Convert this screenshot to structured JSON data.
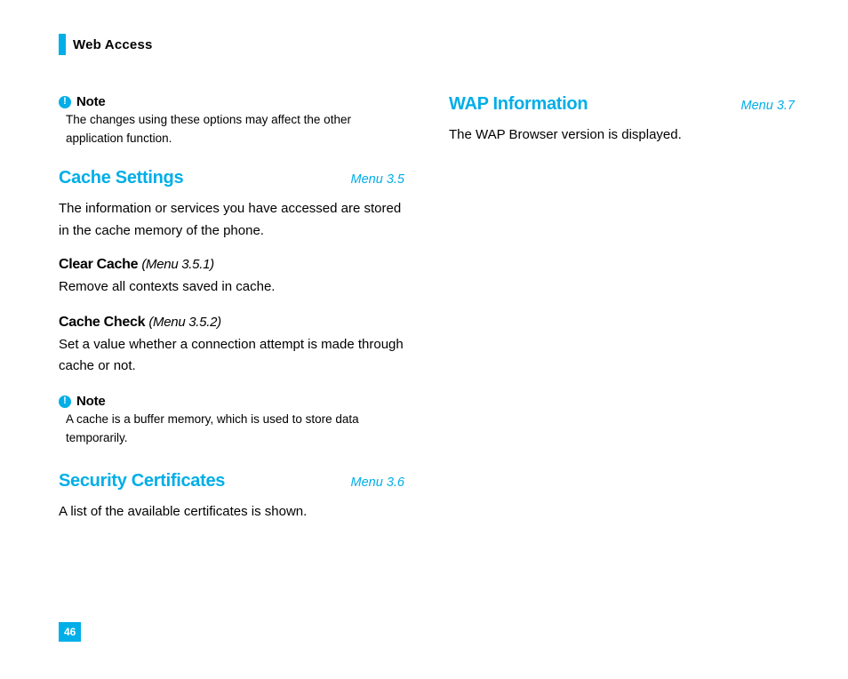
{
  "chapter": "Web Access",
  "page_number": "46",
  "note_icon_glyph": "!",
  "left": {
    "note1": {
      "label": "Note",
      "text": "The changes using these options may affect the other application function."
    },
    "s1": {
      "title": "Cache Settings",
      "menu": "Menu 3.5",
      "body": "The information or services you have accessed are stored in the cache memory of the phone."
    },
    "s1a": {
      "title": "Clear Cache",
      "menu": "(Menu 3.5.1)",
      "body": "Remove all contexts saved in cache."
    },
    "s1b": {
      "title": "Cache Check",
      "menu": "(Menu 3.5.2)",
      "body": "Set a value whether a connection attempt is made through cache or not."
    },
    "note2": {
      "label": "Note",
      "text": "A cache is a buffer memory, which is used to store data temporarily."
    },
    "s2": {
      "title": "Security Certificates",
      "menu": "Menu 3.6",
      "body": "A list of the available certificates is shown."
    }
  },
  "right": {
    "s3": {
      "title": "WAP Information",
      "menu": "Menu 3.7",
      "body": "The WAP Browser version is displayed."
    }
  }
}
